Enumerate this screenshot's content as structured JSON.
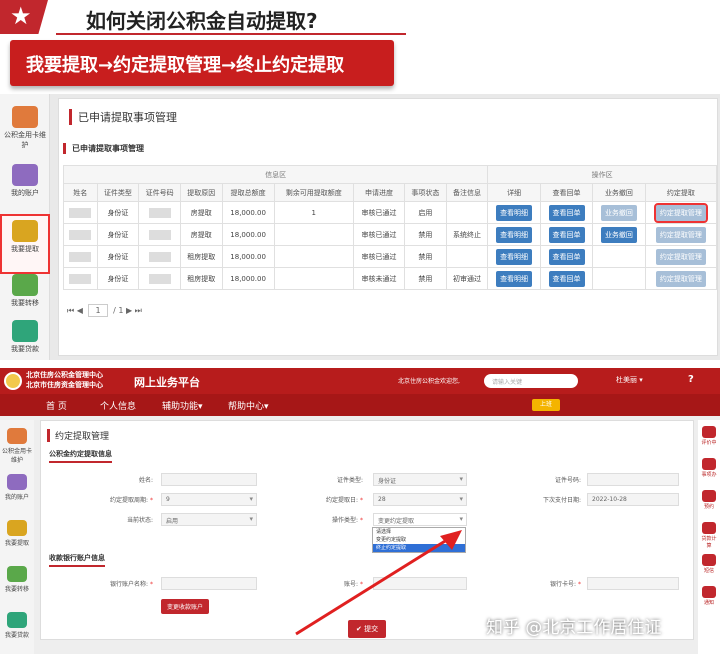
{
  "title": "如何关闭公积金自动提取?",
  "banner": "我要提取→约定提取管理→终止约定提取",
  "shot1": {
    "sidebar": [
      {
        "label": "公积金用卡维护"
      },
      {
        "label": "我的账户"
      },
      {
        "label": "我要提取"
      },
      {
        "label": "我要转移"
      },
      {
        "label": "我要贷款"
      }
    ],
    "panel_title": "已申请提取事项管理",
    "sub_title": "已申请提取事项管理",
    "group_info": "信息区",
    "group_ops": "操作区",
    "headers": [
      "姓名",
      "证件类型",
      "证件号码",
      "提取原因",
      "提取总额度",
      "剩余可用提取额度",
      "申请进度",
      "事项状态",
      "备注信息",
      "详细",
      "查看回单",
      "业务撤回",
      "约定提取"
    ],
    "rows": [
      {
        "idtype": "身份证",
        "reason": "房提取",
        "total": "18,000.00",
        "remain": "1",
        "progress": "审核已通过",
        "status": "启用",
        "remark": "",
        "detail": "查看明细",
        "receipt": "查看回单",
        "withdraw": "业务撤回",
        "agree": "约定提取管理"
      },
      {
        "idtype": "身份证",
        "reason": "房提取",
        "total": "18,000.00",
        "remain": "",
        "progress": "审核已通过",
        "status": "禁用",
        "remark": "系统终止",
        "detail": "查看明细",
        "receipt": "查看回单",
        "withdraw": "业务撤回",
        "agree": "约定提取管理"
      },
      {
        "idtype": "身份证",
        "reason": "租房提取",
        "total": "18,000.00",
        "remain": "",
        "progress": "审核已通过",
        "status": "禁用",
        "remark": "",
        "detail": "查看明细",
        "receipt": "查看回单",
        "withdraw": "",
        "agree": "约定提取管理"
      },
      {
        "idtype": "身份证",
        "reason": "租房提取",
        "total": "18,000.00",
        "remain": "",
        "progress": "审核未通过",
        "status": "禁用",
        "remark": "初审通过",
        "detail": "查看明细",
        "receipt": "查看回单",
        "withdraw": "",
        "agree": "约定提取管理"
      }
    ],
    "pager": {
      "page": "1",
      "total": "/ 1"
    }
  },
  "shot2": {
    "org_line1": "北京住房公积金管理中心",
    "org_line2": "北京市住房资金管理中心",
    "platform": "网上业务平台",
    "welcome": "北京住房公积金欢迎您,",
    "search_placeholder": "请输入关键",
    "user": "杜美丽 ▾",
    "help": "?",
    "nav": [
      "首 页",
      "个人信息",
      "辅助功能▾",
      "帮助中心▾"
    ],
    "nav_badge": "上班",
    "sidebar": [
      {
        "label": "公积金用卡维护"
      },
      {
        "label": "我的账户"
      },
      {
        "label": "我要提取"
      },
      {
        "label": "我要转移"
      },
      {
        "label": "我要贷款"
      }
    ],
    "right_sidebar": [
      "评价中",
      "事项办",
      "预约",
      "贷款计算",
      "短信",
      "通知"
    ],
    "panel_title": "约定提取管理",
    "section1": "公积金约定提取信息",
    "section2": "收款银行账户信息",
    "fields": {
      "name_label": "姓名:",
      "idtype_label": "证件类型:",
      "idtype_value": "身份证",
      "idno_label": "证件号码:",
      "cycle_label": "约定提取周期:",
      "cycle_value": "9",
      "day_label": "约定提取日:",
      "day_value": "28",
      "next_label": "下次支付日期:",
      "next_value": "2022-10-28",
      "state_label": "当前状态:",
      "state_value": "启用",
      "op_label": "操作类型:",
      "op_value": "变更约定提取",
      "acct_name_label": "银行账户名称:",
      "acct_label": "账号:",
      "card_label": "银行卡号:",
      "change_btn": "变更收款账户",
      "submit_btn": "✔ 提交"
    },
    "dropdown": [
      "请选择",
      "变更约定提取",
      "终止约定提取"
    ]
  },
  "watermark": "知乎 @北京工作居住证"
}
